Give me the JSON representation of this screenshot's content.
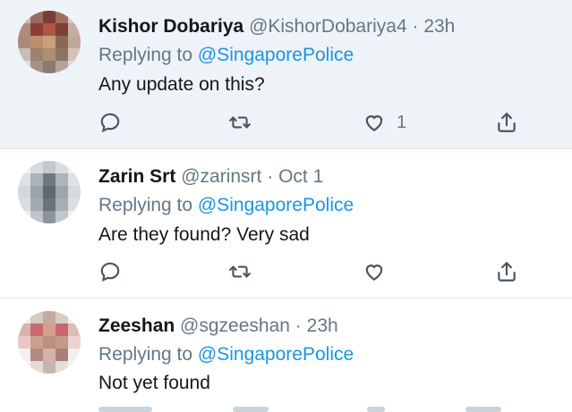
{
  "tweets": [
    {
      "name": "Kishor Dobariya",
      "handle": "@KishorDobariya4",
      "separator": "·",
      "time": "23h",
      "replying_prefix": "Replying to",
      "replying_to": "@SingaporePolice",
      "text": "Any update on this?",
      "like_count": "1"
    },
    {
      "name": "Zarin Srt",
      "handle": "@zarinsrt",
      "separator": "·",
      "time": "Oct 1",
      "replying_prefix": "Replying to",
      "replying_to": "@SingaporePolice",
      "text": "Are they found? Very sad",
      "like_count": ""
    },
    {
      "name": "Zeeshan",
      "handle": "@sgzeeshan",
      "separator": "·",
      "time": "23h",
      "replying_prefix": "Replying to",
      "replying_to": "@SingaporePolice",
      "text": "Not yet found"
    }
  ],
  "colors": {
    "highlight_bg": "#eef3f8",
    "mention": "#1b95e0",
    "secondary_text": "#657786",
    "divider": "#e1e8ed"
  },
  "icons": [
    "reply-icon",
    "retweet-icon",
    "like-icon",
    "share-icon"
  ]
}
